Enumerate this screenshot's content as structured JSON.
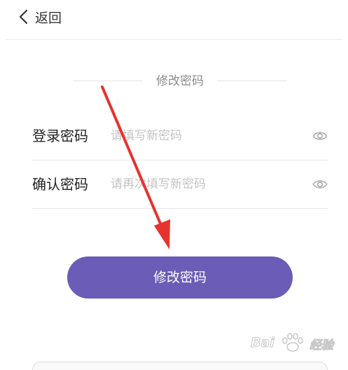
{
  "header": {
    "back_label": "返回"
  },
  "form": {
    "section_title": "修改密码",
    "fields": [
      {
        "label": "登录密码",
        "placeholder": "请填写新密码"
      },
      {
        "label": "确认密码",
        "placeholder": "请再次填写新密码"
      }
    ],
    "submit_label": "修改密码"
  },
  "watermark": {
    "text_left": "Bai",
    "text_right": "经验"
  },
  "icons": {
    "back": "chevron-left-icon",
    "password_toggle": "eye-icon"
  },
  "colors": {
    "accent": "#6a5cb7",
    "arrow": "#e8322f"
  }
}
